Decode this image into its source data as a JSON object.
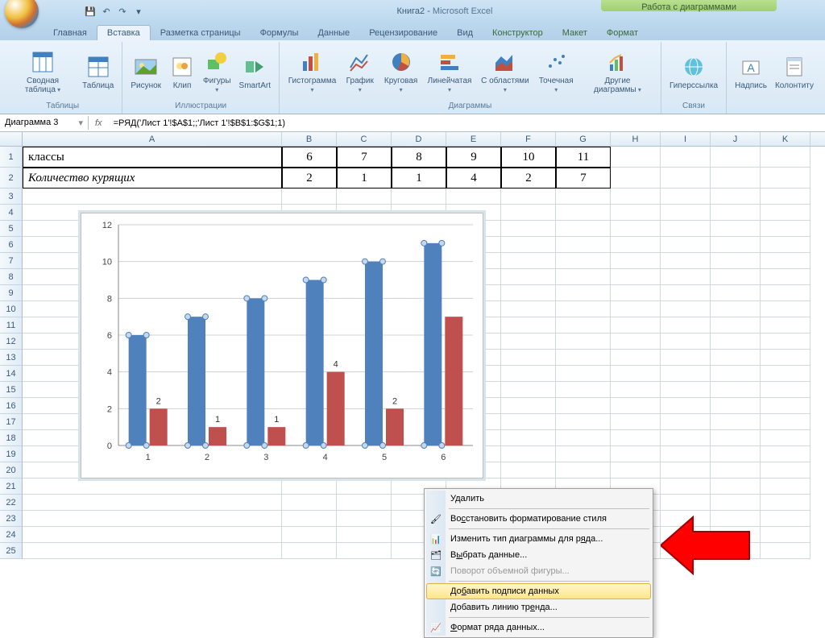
{
  "window": {
    "title_doc": "Книга2",
    "title_app": "Microsoft Excel",
    "chart_tools": "Работа с диаграммами"
  },
  "tabs": {
    "home": "Главная",
    "insert": "Вставка",
    "layout": "Разметка страницы",
    "formulas": "Формулы",
    "data": "Данные",
    "review": "Рецензирование",
    "view": "Вид",
    "design": "Конструктор",
    "layout2": "Макет",
    "format": "Формат"
  },
  "ribbon": {
    "tables": {
      "label": "Таблицы",
      "pivot": "Сводная таблица",
      "table": "Таблица"
    },
    "illus": {
      "label": "Иллюстрации",
      "picture": "Рисунок",
      "clip": "Клип",
      "shapes": "Фигуры",
      "smartart": "SmartArt"
    },
    "charts": {
      "label": "Диаграммы",
      "column": "Гистограмма",
      "line": "График",
      "pie": "Круговая",
      "bar": "Линейчатая",
      "area": "С областями",
      "scatter": "Точечная",
      "other": "Другие диаграммы"
    },
    "links": {
      "label": "Связи",
      "hyperlink": "Гиперссылка"
    },
    "text": {
      "textbox": "Надпись",
      "header": "Колонтиту"
    }
  },
  "formula": {
    "name": "Диаграмма 3",
    "fx": "fx",
    "value": "=РЯД('Лист 1'!$A$1;;'Лист 1'!$B$1:$G$1;1)"
  },
  "columns": [
    "A",
    "B",
    "C",
    "D",
    "E",
    "F",
    "G",
    "H",
    "I",
    "J",
    "K"
  ],
  "table": {
    "row1_label": "классы",
    "row1": [
      "6",
      "7",
      "8",
      "9",
      "10",
      "11"
    ],
    "row2_label": "Количество курящих",
    "row2": [
      "2",
      "1",
      "1",
      "4",
      "2",
      "7"
    ]
  },
  "chart_data": {
    "type": "bar",
    "categories": [
      "1",
      "2",
      "3",
      "4",
      "5",
      "6"
    ],
    "series": [
      {
        "name": "классы",
        "values": [
          6,
          7,
          8,
          9,
          10,
          11
        ]
      },
      {
        "name": "Количество курящих",
        "values": [
          2,
          1,
          1,
          4,
          2,
          7
        ]
      }
    ],
    "data_labels_series2": [
      "2",
      "1",
      "1",
      "4",
      "2",
      ""
    ],
    "ylim": [
      0,
      12
    ],
    "yticks": [
      0,
      2,
      4,
      6,
      8,
      10,
      12
    ]
  },
  "context_menu": {
    "delete": "Удалить",
    "reset": "Восстановить форматирование стиля",
    "change_type": "Изменить тип диаграммы для ряда...",
    "select_data": "Выбрать данные...",
    "rotate_3d": "Поворот объемной фигуры...",
    "add_labels": "Добавить подписи данных",
    "add_trend": "Добавить линию тренда...",
    "format_series": "Формат ряда данных..."
  }
}
